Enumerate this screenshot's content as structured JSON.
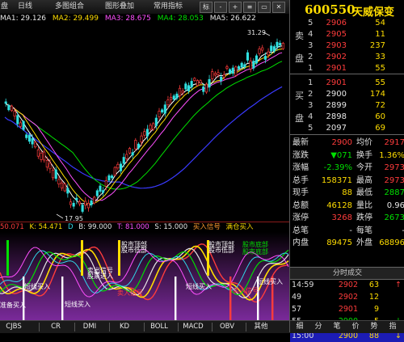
{
  "toolbar": {
    "items": [
      "盘",
      "日线",
      "多图组合",
      "图形叠加",
      "常用指标"
    ],
    "buttons": [
      "标",
      "-",
      "+",
      "≡",
      "▭",
      "✕",
      "▭"
    ]
  },
  "ma_legend": [
    {
      "text": "MA1: 29.126",
      "color": "#e6e6e6"
    },
    {
      "text": "MA2: 29.499",
      "color": "#ffdd00"
    },
    {
      "text": "MA3: 28.675",
      "color": "#ff50ff"
    },
    {
      "text": "MA4: 28.053",
      "color": "#00e000"
    },
    {
      "text": "MA5: 26.622",
      "color": "#e6e6e6"
    }
  ],
  "price_chart": {
    "high_label": "31.29",
    "low_label": "17.95",
    "colors": {
      "up": "#ff3c3c",
      "down": "#30e0e0",
      "ma1": "#ffffff",
      "ma2": "#ffdd00",
      "ma3": "#ff50ff",
      "ma4": "#00e000",
      "ma5": "#3a3aff"
    }
  },
  "indicator_header": [
    {
      "text": "50.071",
      "color": "#ff3c3c"
    },
    {
      "text": "K: 54.471",
      "color": "#ffdd00"
    },
    {
      "text": "D",
      "color": "#30d8e8"
    },
    {
      "text": "B: 99.000",
      "color": "#e6e6e6"
    },
    {
      "text": "T: 81.000",
      "color": "#ff50ff"
    },
    {
      "text": "S: 15.000",
      "color": "#e6e6e6"
    },
    {
      "text": "买入信号",
      "color": "#ff9a30"
    },
    {
      "text": "满仓买入",
      "color": "#ffdd00"
    }
  ],
  "indicator_labels": [
    "短线买入",
    "准备买入",
    "股市顶部",
    "股市低部",
    "卖出信号",
    "股票进入",
    "卖入信号",
    "股市底部"
  ],
  "bottom_tabs": [
    "CJBS",
    "CR",
    "DMI",
    "KD",
    "BOLL",
    "MACD",
    "OBV",
    "其他"
  ],
  "stock": {
    "code": "600550",
    "name": "天威保变"
  },
  "orderbook": {
    "sell_side_label": [
      "卖",
      "盘"
    ],
    "buy_side_label": [
      "买",
      "盘"
    ],
    "sell": [
      {
        "lv": "5",
        "price": "2906",
        "vol": "54"
      },
      {
        "lv": "4",
        "price": "2905",
        "vol": "11"
      },
      {
        "lv": "3",
        "price": "2903",
        "vol": "237"
      },
      {
        "lv": "2",
        "price": "2902",
        "vol": "33"
      },
      {
        "lv": "1",
        "price": "2901",
        "vol": "55"
      }
    ],
    "buy": [
      {
        "lv": "1",
        "price": "2901",
        "vol": "55"
      },
      {
        "lv": "2",
        "price": "2900",
        "vol": "174"
      },
      {
        "lv": "3",
        "price": "2899",
        "vol": "72"
      },
      {
        "lv": "4",
        "price": "2898",
        "vol": "60"
      },
      {
        "lv": "5",
        "price": "2097",
        "vol": "69"
      }
    ]
  },
  "stats": [
    {
      "l1": "最新",
      "v1": "2900",
      "c1": "#ff3c3c",
      "l2": "均价",
      "v2": "2917",
      "c2": "#ff3c3c"
    },
    {
      "l1": "涨跌",
      "v1": "▼071",
      "c1": "#00e000",
      "l2": "换手",
      "v2": "1.36%",
      "c2": "#ffdd00"
    },
    {
      "l1": "涨幅",
      "v1": "-2.39%",
      "c1": "#00e000",
      "l2": "今开",
      "v2": "2973",
      "c2": "#ff3c3c"
    },
    {
      "l1": "总手",
      "v1": "158371",
      "c1": "#ffdd00",
      "l2": "最高",
      "v2": "2973",
      "c2": "#ff3c3c"
    },
    {
      "l1": "现手",
      "v1": "88",
      "c1": "#ffdd00",
      "l2": "最低",
      "v2": "2887",
      "c2": "#00e000"
    },
    {
      "l1": "总额",
      "v1": "46128",
      "c1": "#ffdd00",
      "l2": "量比",
      "v2": "0.96",
      "c2": "#e6e6e6"
    },
    {
      "l1": "涨停",
      "v1": "3268",
      "c1": "#ff3c3c",
      "l2": "跌停",
      "v2": "2673",
      "c2": "#00e000"
    },
    {
      "l1": "总笔",
      "v1": "-",
      "c1": "#e6e6e6",
      "l2": "每笔",
      "v2": "-",
      "c2": "#e6e6e6"
    },
    {
      "l1": "内盘",
      "v1": "89475",
      "c1": "#ffdd00",
      "l2": "外盘",
      "v2": "68896",
      "c2": "#ffdd00"
    }
  ],
  "trade_header": "分时成交",
  "trades": [
    {
      "time": "14:59",
      "price": "2902",
      "dir": "↑",
      "vol": "63",
      "n": "",
      "pc": "#ff3c3c"
    },
    {
      "time": "49",
      "price": "2902",
      "dir": "",
      "vol": "12",
      "n": "",
      "pc": "#ff3c3c"
    },
    {
      "time": "57",
      "price": "2901",
      "dir": "",
      "vol": "9",
      "n": "",
      "pc": "#ff3c3c"
    },
    {
      "time": "55",
      "price": "2900",
      "dir": "↓",
      "vol": "5",
      "n": "",
      "pc": "#00e000"
    },
    {
      "time": "15:00",
      "price": "2900",
      "dir": "↓",
      "vol": "88",
      "n": "",
      "pc": "#ffdd00"
    }
  ],
  "right_tabs": [
    "细",
    "分",
    "笔",
    "价",
    "势",
    "指"
  ]
}
